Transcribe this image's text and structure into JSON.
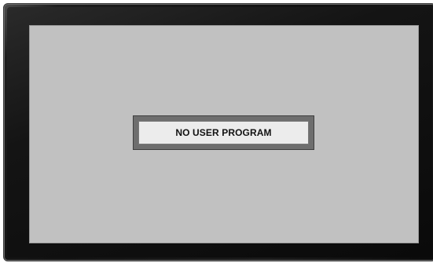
{
  "screen": {
    "message": "NO USER PROGRAM"
  },
  "colors": {
    "bezel": "#141414",
    "screen_background": "#c1c1c1",
    "message_box_background": "#ececec",
    "message_box_border": "#6e6e6e",
    "message_text": "#111111"
  }
}
